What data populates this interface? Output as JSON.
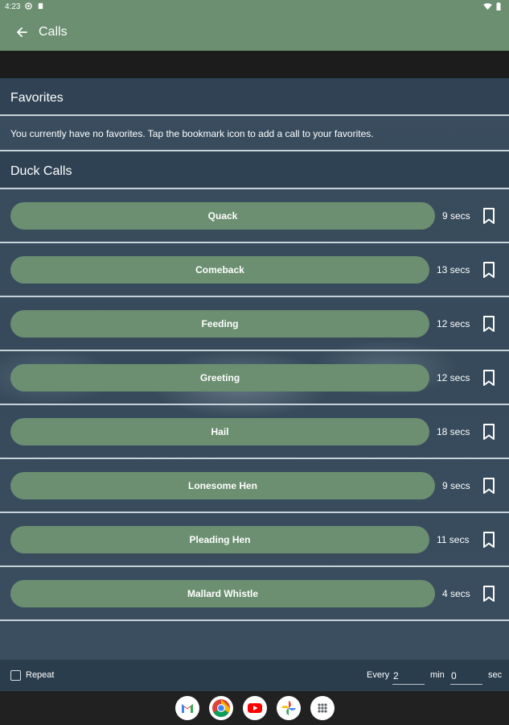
{
  "status_bar": {
    "time": "4:23"
  },
  "app_bar": {
    "title": "Calls"
  },
  "favorites": {
    "heading": "Favorites",
    "empty_message": "You currently have no favorites. Tap the bookmark icon to add a call to your favorites."
  },
  "duck_calls": {
    "heading": "Duck Calls",
    "items": [
      {
        "label": "Quack",
        "duration": "9 secs"
      },
      {
        "label": "Comeback",
        "duration": "13 secs"
      },
      {
        "label": "Feeding",
        "duration": "12 secs"
      },
      {
        "label": "Greeting",
        "duration": "12 secs"
      },
      {
        "label": "Hail",
        "duration": "18 secs"
      },
      {
        "label": "Lonesome Hen",
        "duration": "9 secs"
      },
      {
        "label": "Pleading Hen",
        "duration": "11 secs"
      },
      {
        "label": "Mallard Whistle",
        "duration": "4 secs"
      }
    ]
  },
  "bottom_bar": {
    "repeat_label": "Repeat",
    "repeat_checked": false,
    "every_label": "Every",
    "minutes_value": "2",
    "min_label": "min",
    "seconds_value": "0",
    "sec_label": "sec"
  },
  "dock": {
    "apps": [
      "gmail-icon",
      "chrome-icon",
      "youtube-icon",
      "photos-icon",
      "app-drawer-icon"
    ]
  },
  "colors": {
    "accent": "#6b8f70",
    "content_bg": "#3a4d5e",
    "bar_bg": "#2a3d4d"
  }
}
